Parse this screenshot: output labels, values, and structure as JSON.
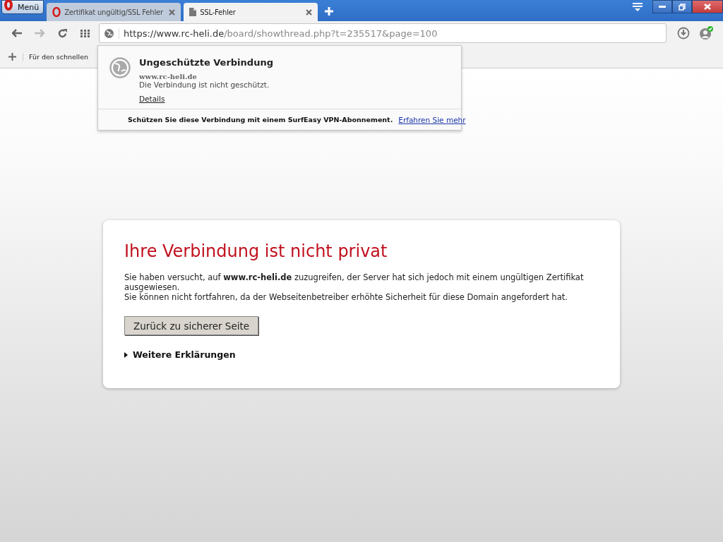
{
  "menu_button": {
    "label": "Menü"
  },
  "tabs": [
    {
      "title": "Zertifikat ungültig/SSL Fehler",
      "selected": false
    },
    {
      "title": "SSL-Fehler",
      "selected": true
    }
  ],
  "address_bar": {
    "host": "https://www.rc-heli.de",
    "path": "/board/showthread.php?t=235517&page=100"
  },
  "bookmarks_bar": {
    "items": [
      "Für den schnellen"
    ]
  },
  "security_popup": {
    "title": "Ungeschützte Verbindung",
    "site": "www.rc-heli.de",
    "message": "Die Verbindung ist nicht geschützt.",
    "details_link": "Details",
    "vpn_text": "Schützen Sie diese Verbindung mit einem SurfEasy VPN-Abonnement.",
    "vpn_link": "Erfahren Sie mehr"
  },
  "error_card": {
    "heading": "Ihre Verbindung ist nicht privat",
    "paragraphs": [
      "Sie haben versucht, auf **www.rc-heli.de** zuzugreifen, der Server hat sich jedoch mit einem ungültigen Zertifikat ausgewiesen.",
      "Sie können nicht fortfahren, da der Webseitenbetreiber erhöhte Sicherheit für diese Domain angefordert hat."
    ],
    "back_button": "Zurück zu sicherer Seite",
    "more_toggle": {
      "label": "Weitere Erklärungen",
      "expanded": false
    }
  }
}
